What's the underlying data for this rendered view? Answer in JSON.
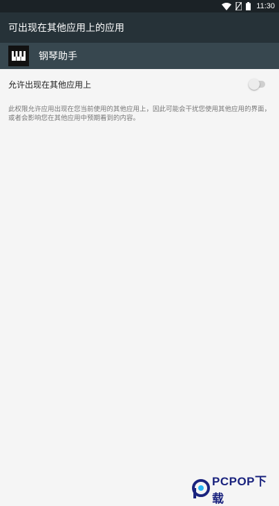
{
  "status_bar": {
    "time": "11:30",
    "icons": [
      "wifi-icon",
      "sim-off-icon",
      "battery-icon"
    ]
  },
  "toolbar": {
    "title": "可出现在其他应用上的应用"
  },
  "app": {
    "name": "钢琴助手",
    "icon": "piano-icon"
  },
  "setting": {
    "label": "允许出现在其他应用上",
    "enabled": false
  },
  "description": "此权限允许应用出现在您当前使用的其他应用上，因此可能会干扰您使用其他应用的界面，或者会影响您在其他应用中预期看到的内容。",
  "watermark": {
    "text": "PCPOP下载",
    "color": "#1a237e"
  },
  "colors": {
    "status_bar": "#1b2226",
    "toolbar": "#263238",
    "app_header": "#37474f",
    "background": "#f5f5f5"
  }
}
